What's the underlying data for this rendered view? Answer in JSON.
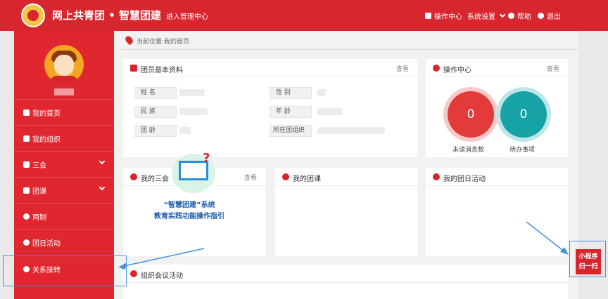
{
  "header": {
    "brand": "网上共青团 • 智慧团建",
    "enter_admin": "进入管理中心",
    "nav": {
      "operation_center": "操作中心",
      "system_settings": "系统设置",
      "help": "帮助",
      "logout": "退出"
    }
  },
  "sidebar": {
    "items": [
      {
        "label": "我的首页",
        "icon": "home-icon"
      },
      {
        "label": "我的组织",
        "icon": "users-icon"
      },
      {
        "label": "三会",
        "icon": "checkbox-icon",
        "expandable": true
      },
      {
        "label": "团课",
        "icon": "folder-icon",
        "expandable": true
      },
      {
        "label": "两制",
        "icon": "circle-icon"
      },
      {
        "label": "团日活动",
        "icon": "flag-icon"
      },
      {
        "label": "关系接转",
        "icon": "refresh-icon"
      }
    ]
  },
  "breadcrumb": "当前位置:我的首页",
  "member_profile": {
    "title": "团员基本资料",
    "view": "查看",
    "fields": {
      "name": "姓 名",
      "gender": "性 别",
      "ethnicity": "民 族",
      "age": "年 龄",
      "league_age": "团 龄",
      "org": "所在团组织"
    }
  },
  "operation_center": {
    "title": "操作中心",
    "view": "查看",
    "unread_count": "0",
    "unread_label": "未读消息数",
    "todo_count": "0",
    "todo_label": "待办事项"
  },
  "cards": {
    "sanhui": {
      "title": "我的三会",
      "view": "查看"
    },
    "tuanke": {
      "title": "我的团课"
    },
    "tuanri": {
      "title": "我的团日活动"
    },
    "meeting": {
      "title": "组织会议活动"
    }
  },
  "overlay": {
    "line1": "“智慧团建”系统",
    "line2": "教育实践功能操作指引"
  },
  "mini_program": {
    "line1": "小程序",
    "line2": "扫一扫"
  },
  "colors": {
    "accent": "#d7262e",
    "teal": "#17a2a6",
    "callout": "#4a90d9"
  }
}
